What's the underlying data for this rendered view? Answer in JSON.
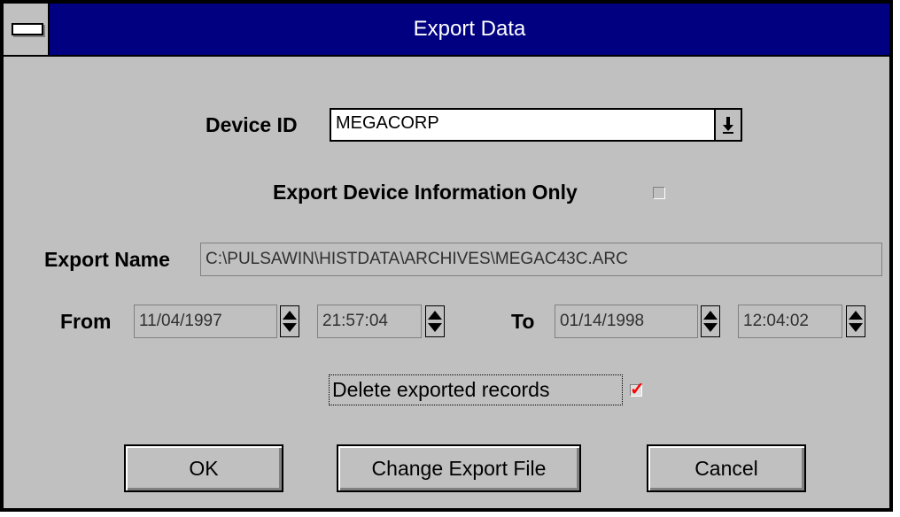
{
  "window": {
    "title": "Export Data"
  },
  "device": {
    "label": "Device ID",
    "value": "MEGACORP",
    "dropdown_icon": "arrow-down-icon"
  },
  "export_info_only": {
    "label": "Export Device Information Only",
    "checked": false
  },
  "export_name": {
    "label": "Export Name",
    "value": "C:\\PULSAWIN\\HISTDATA\\ARCHIVES\\MEGAC43C.ARC"
  },
  "range": {
    "from_label": "From",
    "from_date": "11/04/1997",
    "from_time": "21:57:04",
    "to_label": "To",
    "to_date": "01/14/1998",
    "to_time": "12:04:02"
  },
  "delete_records": {
    "label": "Delete exported records",
    "checked": true,
    "mark_color": "#ff0000"
  },
  "buttons": {
    "ok": "OK",
    "change_file": "Change Export File",
    "cancel": "Cancel"
  },
  "colors": {
    "titlebar": "#000080",
    "face": "#c0c0c0"
  }
}
